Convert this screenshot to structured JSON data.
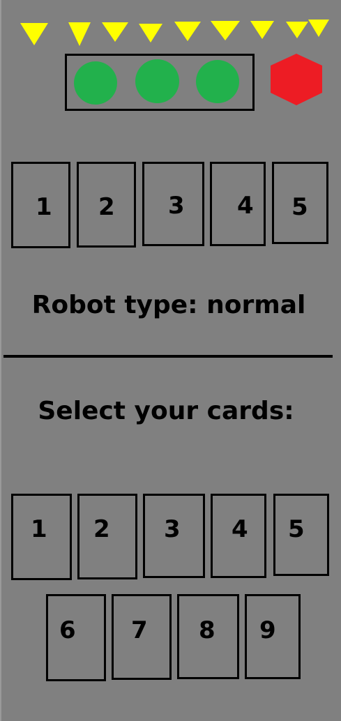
{
  "energy_indicators": [
    "triangle",
    "triangle",
    "triangle",
    "triangle",
    "triangle",
    "triangle",
    "triangle",
    "triangle",
    "triangle"
  ],
  "lives": {
    "count": 3,
    "color": "#22b14c"
  },
  "damage_indicator": {
    "shape": "hexagon",
    "color": "#ed1c24"
  },
  "program_slots": [
    "1",
    "2",
    "3",
    "4",
    "5"
  ],
  "robot_type": {
    "text": "Robot type: normal"
  },
  "select_label": "Select your cards:",
  "hand_cards": [
    "1",
    "2",
    "3",
    "4",
    "5",
    "6",
    "7",
    "8",
    "9"
  ],
  "colors": {
    "background": "#808080",
    "indicator": "#ffff00",
    "outline": "#000000"
  }
}
